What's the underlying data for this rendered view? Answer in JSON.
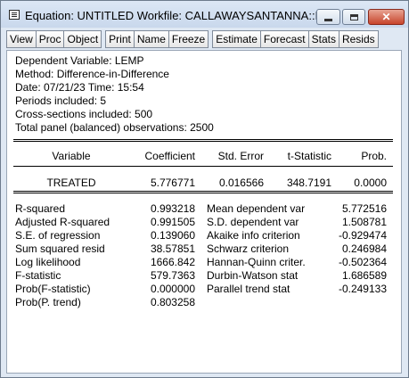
{
  "window": {
    "title": "Equation: UNTITLED   Workfile: CALLAWAYSANTANNA::M..."
  },
  "toolbar": {
    "groups": [
      [
        "View",
        "Proc",
        "Object"
      ],
      [
        "Print",
        "Name",
        "Freeze"
      ],
      [
        "Estimate",
        "Forecast",
        "Stats",
        "Resids"
      ]
    ]
  },
  "header": {
    "lines": [
      "Dependent Variable: LEMP",
      "Method: Difference-in-Difference",
      "Date: 07/21/23   Time: 15:54",
      "Periods included: 5",
      "Cross-sections included: 500",
      "Total panel (balanced) observations: 2500"
    ]
  },
  "coef_table": {
    "columns": [
      "Variable",
      "Coefficient",
      "Std. Error",
      "t-Statistic",
      "Prob."
    ],
    "rows": [
      [
        "TREATED",
        "5.776771",
        "0.016566",
        "348.7191",
        "0.0000"
      ]
    ]
  },
  "stats": {
    "rows": [
      [
        "R-squared",
        "0.993218",
        "Mean dependent var",
        "5.772516"
      ],
      [
        "Adjusted R-squared",
        "0.991505",
        "S.D. dependent var",
        "1.508781"
      ],
      [
        "S.E. of regression",
        "0.139060",
        "Akaike info criterion",
        "-0.929474"
      ],
      [
        "Sum squared resid",
        "38.57851",
        "Schwarz criterion",
        "0.246984"
      ],
      [
        "Log likelihood",
        "1666.842",
        "Hannan-Quinn criter.",
        "-0.502364"
      ],
      [
        "F-statistic",
        "579.7363",
        "Durbin-Watson stat",
        "1.686589"
      ],
      [
        "Prob(F-statistic)",
        "0.000000",
        "Parallel trend stat",
        "-0.249133"
      ],
      [
        "Prob(P. trend)",
        "0.803258",
        "",
        ""
      ]
    ]
  }
}
